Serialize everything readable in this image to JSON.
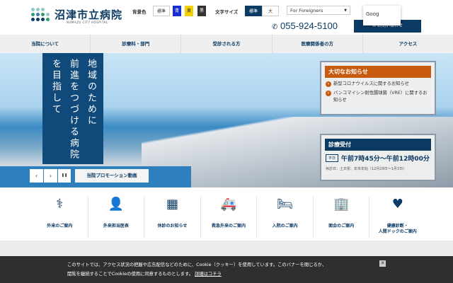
{
  "header": {
    "title": "沼津市立病院",
    "subtitle": "NUMAZU CITY HOSPITAL",
    "bg_label": "背景色",
    "bg_options": [
      "標準",
      "青",
      "黄",
      "黒"
    ],
    "font_label": "文字サイズ",
    "font_options": [
      "標準",
      "大"
    ],
    "language_select": "For Foreigners",
    "google_popup": "Goog",
    "phone": "055-924-5100",
    "contact": "お問い合わせ"
  },
  "nav": [
    "当院について",
    "診療科・部門",
    "受診される方",
    "医療関係者の方",
    "アクセス"
  ],
  "hero": {
    "lines": [
      "地域のために",
      "前進をつづける病院",
      "を目指して"
    ],
    "prev": "‹",
    "next": "›",
    "pause": "❚❚",
    "promo": "当院プロモーション動画"
  },
  "notice": {
    "title": "大切なお知らせ",
    "items": [
      "新型コロナウイルスに関するお知らせ",
      "バンコマイシン耐性腸球菌（VRE）に関するお知らせ"
    ]
  },
  "reception": {
    "title": "診療受付",
    "tag": "平日",
    "hours": "午前7時45分～午前12時00分",
    "note": "休診日：土日祝、年末年始（12月29日～1月3日）"
  },
  "quick_links": [
    {
      "icon": "stethoscope",
      "label": "外来のご案内",
      "glyph": "⚕"
    },
    {
      "icon": "doctor",
      "label": "外来担当医表",
      "glyph": "👤"
    },
    {
      "icon": "calendar",
      "label": "休診のお知らせ",
      "glyph": "▦"
    },
    {
      "icon": "ambulance",
      "label": "救急外来のご案内",
      "glyph": "🚑"
    },
    {
      "icon": "bed",
      "label": "入院のご案内",
      "glyph": "🛏"
    },
    {
      "icon": "building",
      "label": "面会のご案内",
      "glyph": "🏢"
    },
    {
      "icon": "heart",
      "label": "健康診断・\n人間ドックのご案内",
      "glyph": "♥"
    }
  ],
  "cookie": {
    "line1": "このサイトでは、アクセス状況の把握や広告配信などのために、Cookie（クッキー）を使用しています。このバナーを閉じるか、",
    "line2": "閲覧を継続することでCookieの使用に同意するものとします。",
    "link": "詳細はコチラ",
    "close": "✕"
  },
  "colors": {
    "brand": "#0b3a63",
    "notice": "#c85a0e"
  }
}
